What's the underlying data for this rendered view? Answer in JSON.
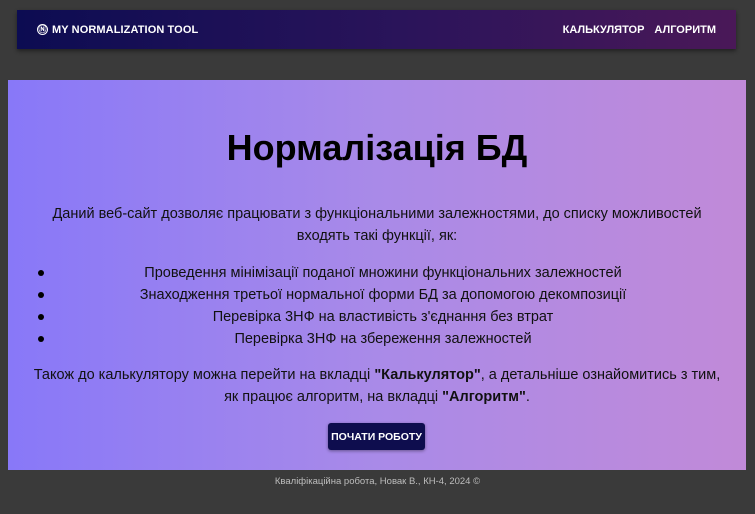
{
  "nav": {
    "brand_icon": "Ⓝ",
    "brand": "MY NORMALIZATION TOOL",
    "links": [
      "КАЛЬКУЛЯТОР",
      "АЛГОРИТМ"
    ]
  },
  "hero": {
    "title": "Нормалізація БД",
    "intro": "Даний веб-сайт дозволяє працювати з функціональними залежностями, до списку можливостей входять такі функції, як:",
    "features": [
      "Проведення мінімізації поданої множини функціональних залежностей",
      "Знаходження третьої нормальної форми БД за допомогою декомпозиції",
      "Перевірка 3НФ на властивість з'єднання без втрат",
      "Перевірка 3НФ на збереження залежностей"
    ],
    "outro": {
      "part1": "Також до калькулятору можна перейти на вкладці ",
      "calc_link": "\"Калькулятор\"",
      "part2": ", а детальніше ознайомитись з тим, як працює алгоритм, на вкладці ",
      "algo_link": "\"Алгоритм\"",
      "part3": "."
    },
    "button": "ПОЧАТИ РОБОТУ"
  },
  "footer": "Кваліфікаційна робота, Новак В., КН-4, 2024 ©",
  "colors": {
    "navbar_start": "#0c0c52",
    "navbar_end": "#4a1858",
    "hero_start": "#8878f8",
    "hero_end": "#c18ad8",
    "button": "#0e0d4e",
    "page_bg": "#3a3a3a"
  }
}
